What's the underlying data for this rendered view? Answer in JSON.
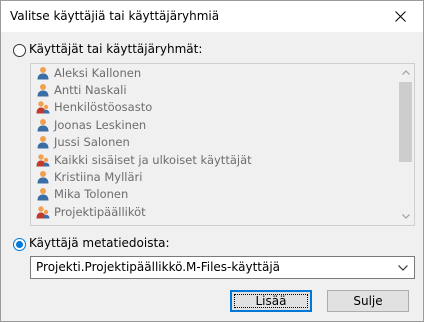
{
  "window": {
    "title": "Valitse käyttäjiä tai käyttäjäryhmiä"
  },
  "options": {
    "users_groups_label": "Käyttäjät tai käyttäjäryhmät:",
    "metadata_label": "Käyttäjä metatiedoista:"
  },
  "list": {
    "items": [
      {
        "label": "Aleksi Kallonen",
        "icon": "user-icon"
      },
      {
        "label": "Antti Naskali",
        "icon": "user-icon"
      },
      {
        "label": "Henkilöstöosasto",
        "icon": "user-group-icon"
      },
      {
        "label": "Joonas Leskinen",
        "icon": "user-icon"
      },
      {
        "label": "Jussi Salonen",
        "icon": "user-icon"
      },
      {
        "label": "Kaikki sisäiset ja ulkoiset käyttäjät",
        "icon": "user-group-icon"
      },
      {
        "label": "Kristiina Mylläri",
        "icon": "user-icon"
      },
      {
        "label": "Mika Tolonen",
        "icon": "user-icon"
      },
      {
        "label": "Projektipäälliköt",
        "icon": "user-group-icon"
      }
    ]
  },
  "combo": {
    "value": "Projekti.Projektipäällikkö.M-Files-käyttäjä"
  },
  "buttons": {
    "add_label": "Lisää",
    "close_label": "Sulje"
  },
  "colors": {
    "accent": "#0078d7",
    "user_head": "#f0a050",
    "user_body": "#3a6ea5",
    "group_red": "#c0392b"
  }
}
